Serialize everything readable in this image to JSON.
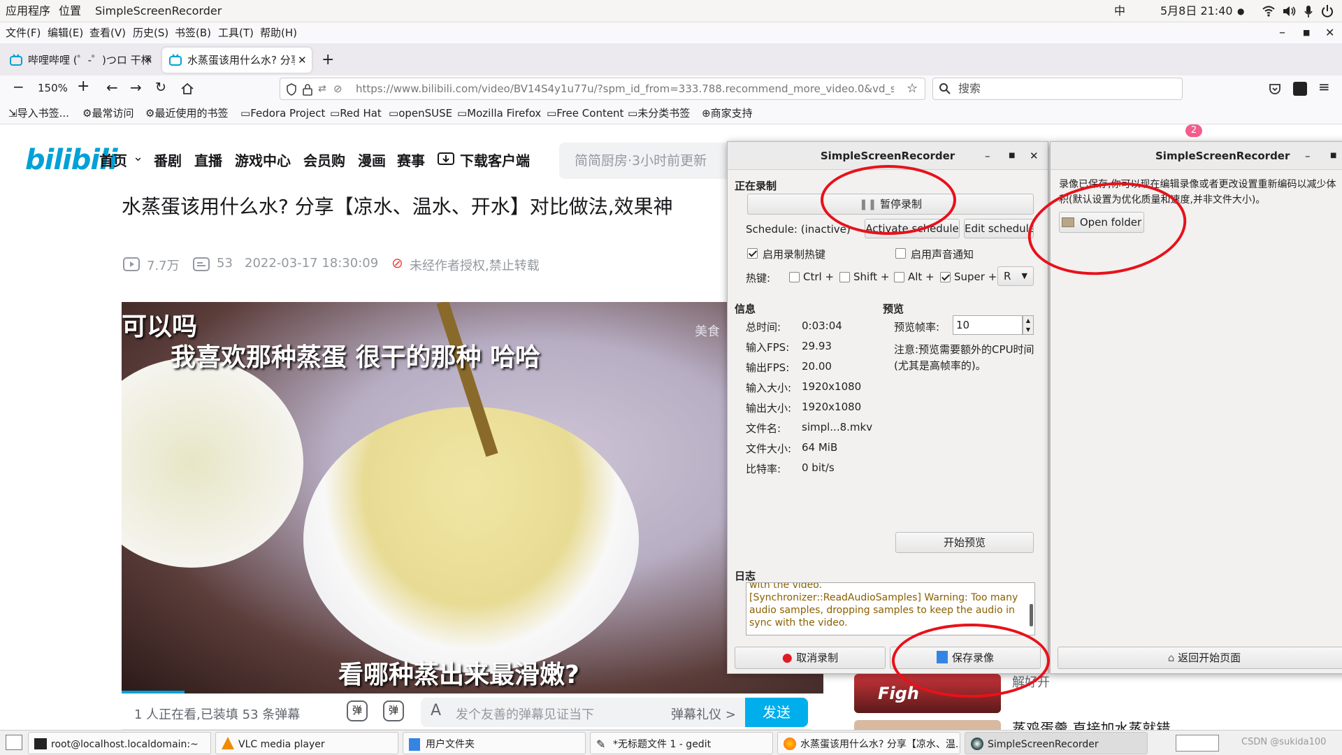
{
  "topbar": {
    "apps": "应用程序",
    "places": "位置",
    "app": "SimpleScreenRecorder",
    "ime": "中",
    "clock": "5月8日 21:40"
  },
  "menu": [
    "文件(F)",
    "编辑(E)",
    "查看(V)",
    "历史(S)",
    "书签(B)",
    "工具(T)",
    "帮助(H)"
  ],
  "tabs": [
    {
      "title": "哔哩哔哩 (゜-゜)つロ 干杯"
    },
    {
      "title": "水蒸蛋该用什么水? 分享"
    }
  ],
  "nav": {
    "zoom": "150%",
    "url": "https://www.bilibili.com/video/BV14S4y1u77u/?spm_id_from=333.788.recommend_more_video.0&vd_source=2af",
    "search_placeholder": "搜索"
  },
  "bookmarks": [
    "导入书签...",
    "最常访问",
    "最近使用的书签",
    "Fedora Project",
    "Red Hat",
    "openSUSE",
    "Mozilla Firefox",
    "Free Content",
    "未分类书签",
    "商家支持"
  ],
  "site": {
    "logo": "bilibili",
    "nav": [
      "首页",
      "番剧",
      "直播",
      "游戏中心",
      "会员购",
      "漫画",
      "赛事",
      "下载客户端"
    ],
    "search_placeholder": "简简厨房·3小时前更新",
    "badge": "2"
  },
  "video": {
    "title": "水蒸蛋该用什么水? 分享【凉水、温水、开水】对比做法,效果神",
    "views": "7.7万",
    "danmaku_count": "53",
    "date": "2022-03-17 18:30:09",
    "notice": "未经作者授权,禁止转载",
    "sub_top": "我喜欢那种蒸蛋 很干的那种 哈哈",
    "sub_prefix": "可以吗",
    "sub_bottom": "看哪种蒸出来最滑嫩?",
    "watermark": "美食",
    "watching": "1 人正在看,已装填 53 条弹幕",
    "danmaku_placeholder": "发个友善的弹幕见证当下",
    "gift": "弹幕礼仪 >",
    "send": "发送",
    "side_text": "解好开",
    "side_title": "蒸鸡蛋羹,直接加水蒸就错",
    "side_thumb": "Figh"
  },
  "ssr": {
    "title": "SimpleScreenRecorder",
    "section_recording": "正在录制",
    "pause": "暂停录制",
    "schedule": "Schedule: (inactive)",
    "activate": "Activate schedule",
    "edit": "Edit schedule",
    "hotkey_enable": "启用录制热键",
    "sound_notify": "启用声音通知",
    "hotkey_label": "热键:",
    "ctrl": "Ctrl +",
    "shift": "Shift +",
    "alt": "Alt +",
    "super": "Super +",
    "key": "R",
    "info_header": "信息",
    "info": [
      {
        "k": "总时间:",
        "v": "0:03:04"
      },
      {
        "k": "输入FPS:",
        "v": "29.93"
      },
      {
        "k": "输出FPS:",
        "v": "20.00"
      },
      {
        "k": "输入大小:",
        "v": "1920x1080"
      },
      {
        "k": "输出大小:",
        "v": "1920x1080"
      },
      {
        "k": "文件名:",
        "v": "simpl...8.mkv"
      },
      {
        "k": "文件大小:",
        "v": "64 MiB"
      },
      {
        "k": "比特率:",
        "v": "0 bit/s"
      }
    ],
    "preview_header": "预览",
    "preview_fps_label": "预览帧率:",
    "preview_fps": "10",
    "preview_note": "注意:预览需要额外的CPU时间(尤其是高帧率的)。",
    "start_preview": "开始预览",
    "log_header": "日志",
    "log_line1": "with the video.",
    "log_line2": "[Synchronizer::ReadAudioSamples] Warning: Too many audio samples, dropping samples to keep the audio in sync with the video.",
    "cancel": "取消录制",
    "save": "保存录像"
  },
  "ssr2": {
    "title": "SimpleScreenRecorder",
    "message": "录像已保存,你可以现在编辑录像或者更改设置重新编码以减少体积(默认设置为优化质量和速度,并非文件大小)。",
    "open_folder": "Open folder",
    "back": "返回开始页面"
  },
  "taskbar": [
    "root@localhost.localdomain:~",
    "VLC media player",
    "用户文件夹",
    "*无标题文件 1 - gedit",
    "水蒸蛋该用什么水? 分享【凉水、温...",
    "SimpleScreenRecorder"
  ],
  "csdn": "CSDN @sukida100"
}
